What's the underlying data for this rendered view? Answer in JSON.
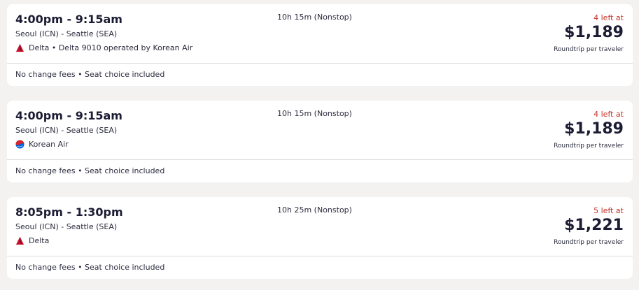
{
  "flights": [
    {
      "times": "4:00pm - 9:15am",
      "route": "Seoul (ICN) - Seattle (SEA)",
      "airline": "Delta • Delta 9010 operated by Korean Air",
      "airline_icon": "delta-logo-icon",
      "duration": "10h 15m (Nonstop)",
      "seats_left": "4 left at",
      "price": "$1,189",
      "price_note": "Roundtrip per traveler",
      "footer": "No change fees • Seat choice included"
    },
    {
      "times": "4:00pm - 9:15am",
      "route": "Seoul (ICN) - Seattle (SEA)",
      "airline": "Korean Air",
      "airline_icon": "korean-air-logo-icon",
      "duration": "10h 15m (Nonstop)",
      "seats_left": "4 left at",
      "price": "$1,189",
      "price_note": "Roundtrip per traveler",
      "footer": "No change fees • Seat choice included"
    },
    {
      "times": "8:05pm - 1:30pm",
      "route": "Seoul (ICN) - Seattle (SEA)",
      "airline": "Delta",
      "airline_icon": "delta-logo-icon",
      "duration": "10h 25m (Nonstop)",
      "seats_left": "5 left at",
      "price": "$1,221",
      "price_note": "Roundtrip per traveler",
      "footer": "No change fees • Seat choice included"
    }
  ],
  "colors": {
    "background": "#f3f2f0",
    "card": "#ffffff",
    "text": "#1b1c33",
    "seats_left": "#c6322a",
    "delta_red": "#c8102e",
    "korean_blue": "#0064de"
  }
}
